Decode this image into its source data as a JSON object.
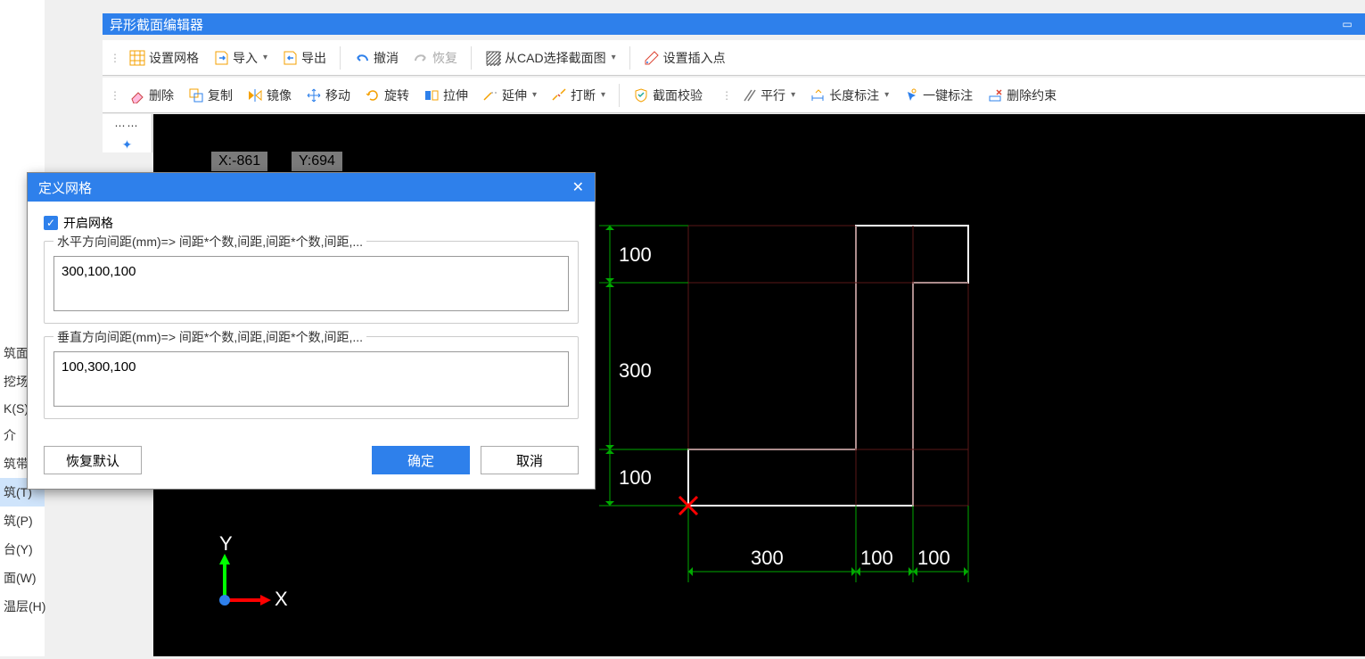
{
  "window": {
    "title": "异形截面编辑器"
  },
  "toolbar1": {
    "set_grid": "设置网格",
    "import": "导入",
    "export": "导出",
    "undo": "撤消",
    "redo": "恢复",
    "from_cad": "从CAD选择截面图",
    "insert_pt": "设置插入点"
  },
  "toolbar2": {
    "delete": "删除",
    "copy": "复制",
    "mirror": "镜像",
    "move": "移动",
    "rotate": "旋转",
    "stretch": "拉伸",
    "extend": "延伸",
    "break": "打断",
    "validate": "截面校验",
    "parallel": "平行",
    "length_dim": "长度标注",
    "one_click": "一键标注",
    "del_constr": "删除约束"
  },
  "left_panel": {
    "items": [
      "筑面积",
      "挖场地",
      "K(S)",
      "介",
      "筑带(",
      "筑(T)",
      "筑(P)",
      "台(Y)",
      "面(W)",
      "温层(H)"
    ],
    "selected_index": 5
  },
  "canvas": {
    "coord_x": "X:-861",
    "coord_y": "Y:694",
    "dims_h": [
      "300",
      "100",
      "100"
    ],
    "dims_v": [
      "100",
      "300",
      "100"
    ],
    "axis_x": "X",
    "axis_y": "Y"
  },
  "dialog": {
    "title": "定义网格",
    "enable_grid": "开启网格",
    "h_label": "水平方向间距(mm)=> 间距*个数,间距,间距*个数,间距,...",
    "h_value": "300,100,100",
    "v_label": "垂直方向间距(mm)=> 间距*个数,间距,间距*个数,间距,...",
    "v_value": "100,300,100",
    "restore": "恢复默认",
    "ok": "确定",
    "cancel": "取消"
  }
}
